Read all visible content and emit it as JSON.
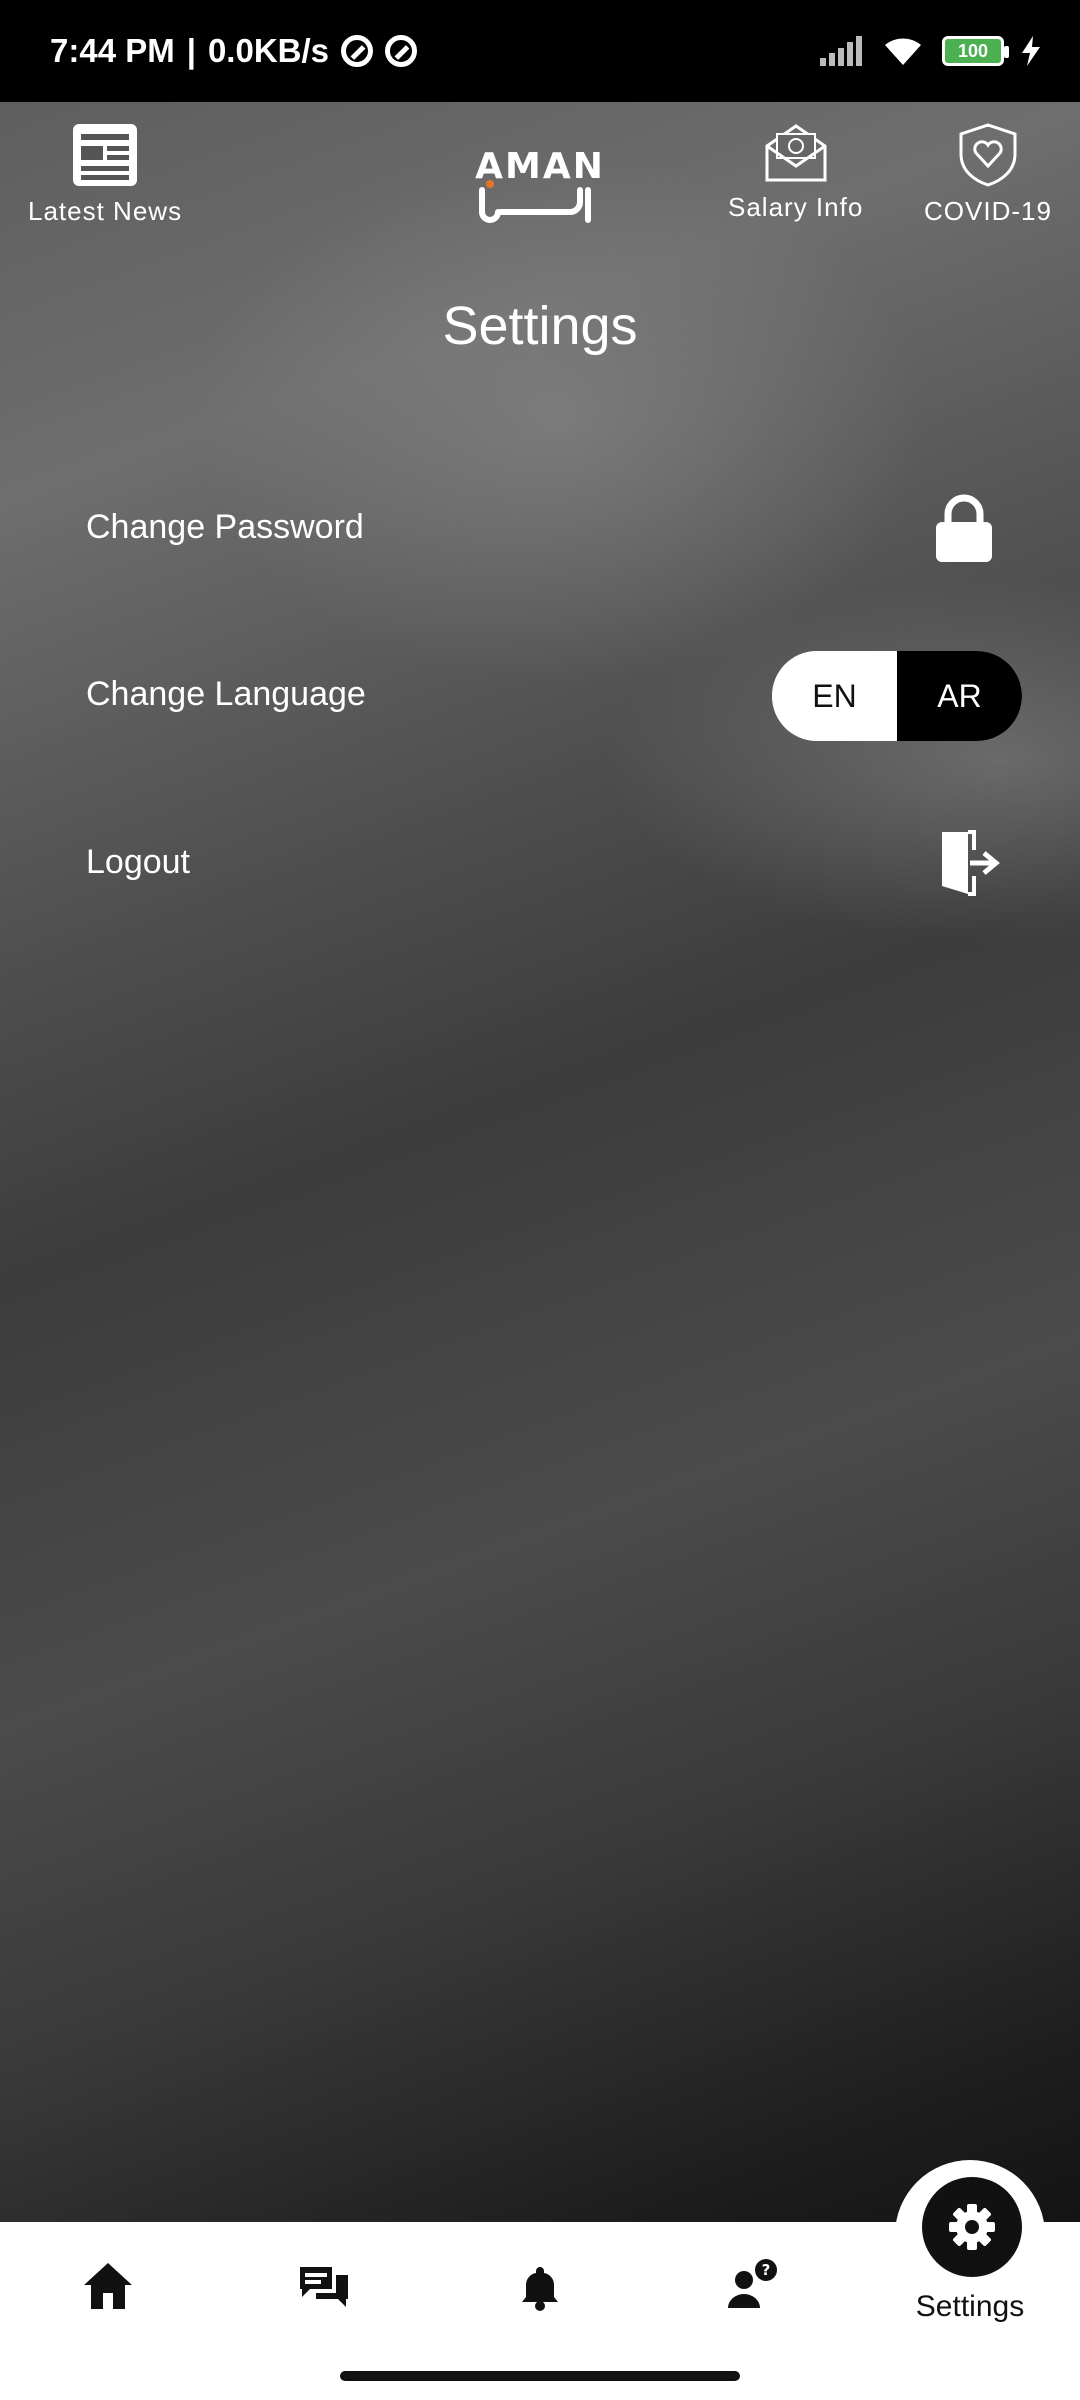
{
  "status_bar": {
    "time": "7:44 PM",
    "separator": "|",
    "network_speed": "0.0KB/s",
    "battery_level": "100"
  },
  "top_nav": {
    "latest_news": "Latest News",
    "salary_info": "Salary Info",
    "covid": "COVID-19",
    "logo_latin": "AMAN",
    "logo_arabic": "أمان"
  },
  "page": {
    "title": "Settings"
  },
  "settings": {
    "change_password": "Change Password",
    "change_language": "Change Language",
    "logout": "Logout",
    "lang_en": "EN",
    "lang_ar": "AR",
    "selected_language": "AR"
  },
  "bottom_nav": {
    "items": [
      "home-icon",
      "chat-icon",
      "bell-icon",
      "help-user-icon",
      "settings-icon"
    ],
    "active_label": "Settings"
  },
  "colors": {
    "accent": "#000000",
    "bar_background": "#ffffff"
  }
}
